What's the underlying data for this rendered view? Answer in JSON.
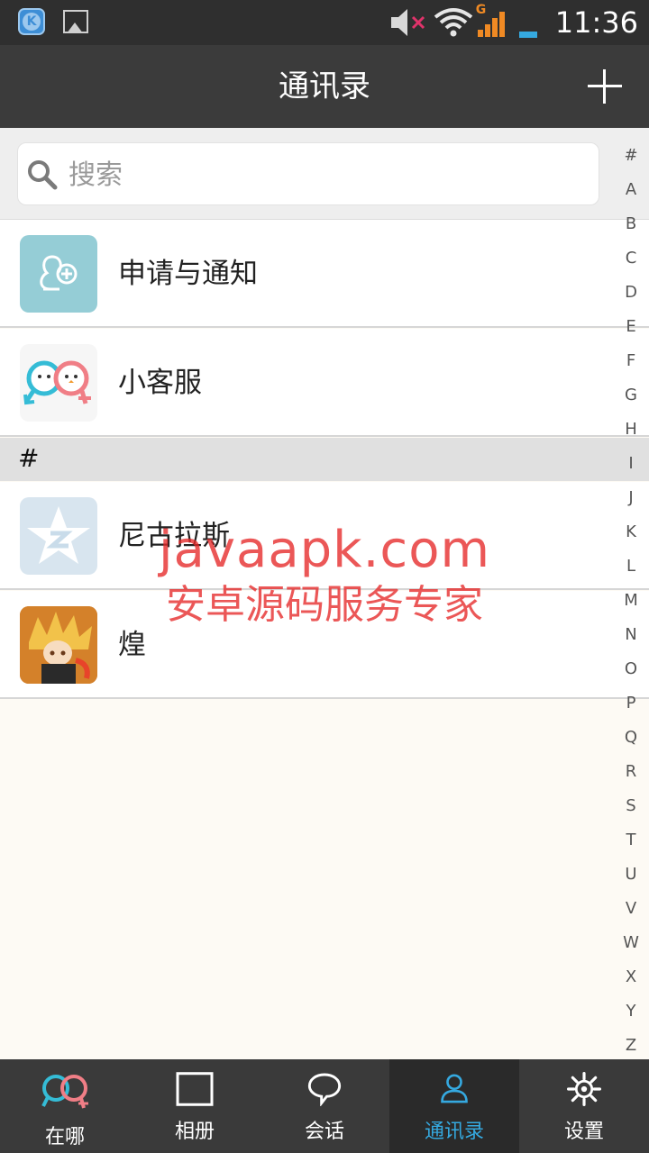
{
  "status_bar": {
    "time": "11:36",
    "signal_label": "G"
  },
  "header": {
    "title": "通讯录"
  },
  "search": {
    "placeholder": "搜索",
    "value": ""
  },
  "contacts_top": [
    {
      "name": "申请与通知",
      "avatar": "add-contact-icon"
    },
    {
      "name": "小客服",
      "avatar": "couple-mascot-icon"
    }
  ],
  "section": {
    "label": "#"
  },
  "contacts": [
    {
      "name": "尼古拉斯",
      "avatar": "qq-star-icon"
    },
    {
      "name": "煌",
      "avatar": "anime-avatar"
    }
  ],
  "alphabet": [
    "#",
    "A",
    "B",
    "C",
    "D",
    "E",
    "F",
    "G",
    "H",
    "I",
    "J",
    "K",
    "L",
    "M",
    "N",
    "O",
    "P",
    "Q",
    "R",
    "S",
    "T",
    "U",
    "V",
    "W",
    "X",
    "Y",
    "Z"
  ],
  "watermark": {
    "line1": "javaapk.com",
    "line2": "安卓源码服务专家"
  },
  "nav": {
    "items": [
      {
        "label": "在哪",
        "icon": "couple-icon"
      },
      {
        "label": "相册",
        "icon": "album-icon"
      },
      {
        "label": "会话",
        "icon": "chat-bubble-icon"
      },
      {
        "label": "通讯录",
        "icon": "contacts-person-icon"
      },
      {
        "label": "设置",
        "icon": "gear-icon"
      }
    ],
    "active_index": 3,
    "active_color": "#35a9e0"
  }
}
